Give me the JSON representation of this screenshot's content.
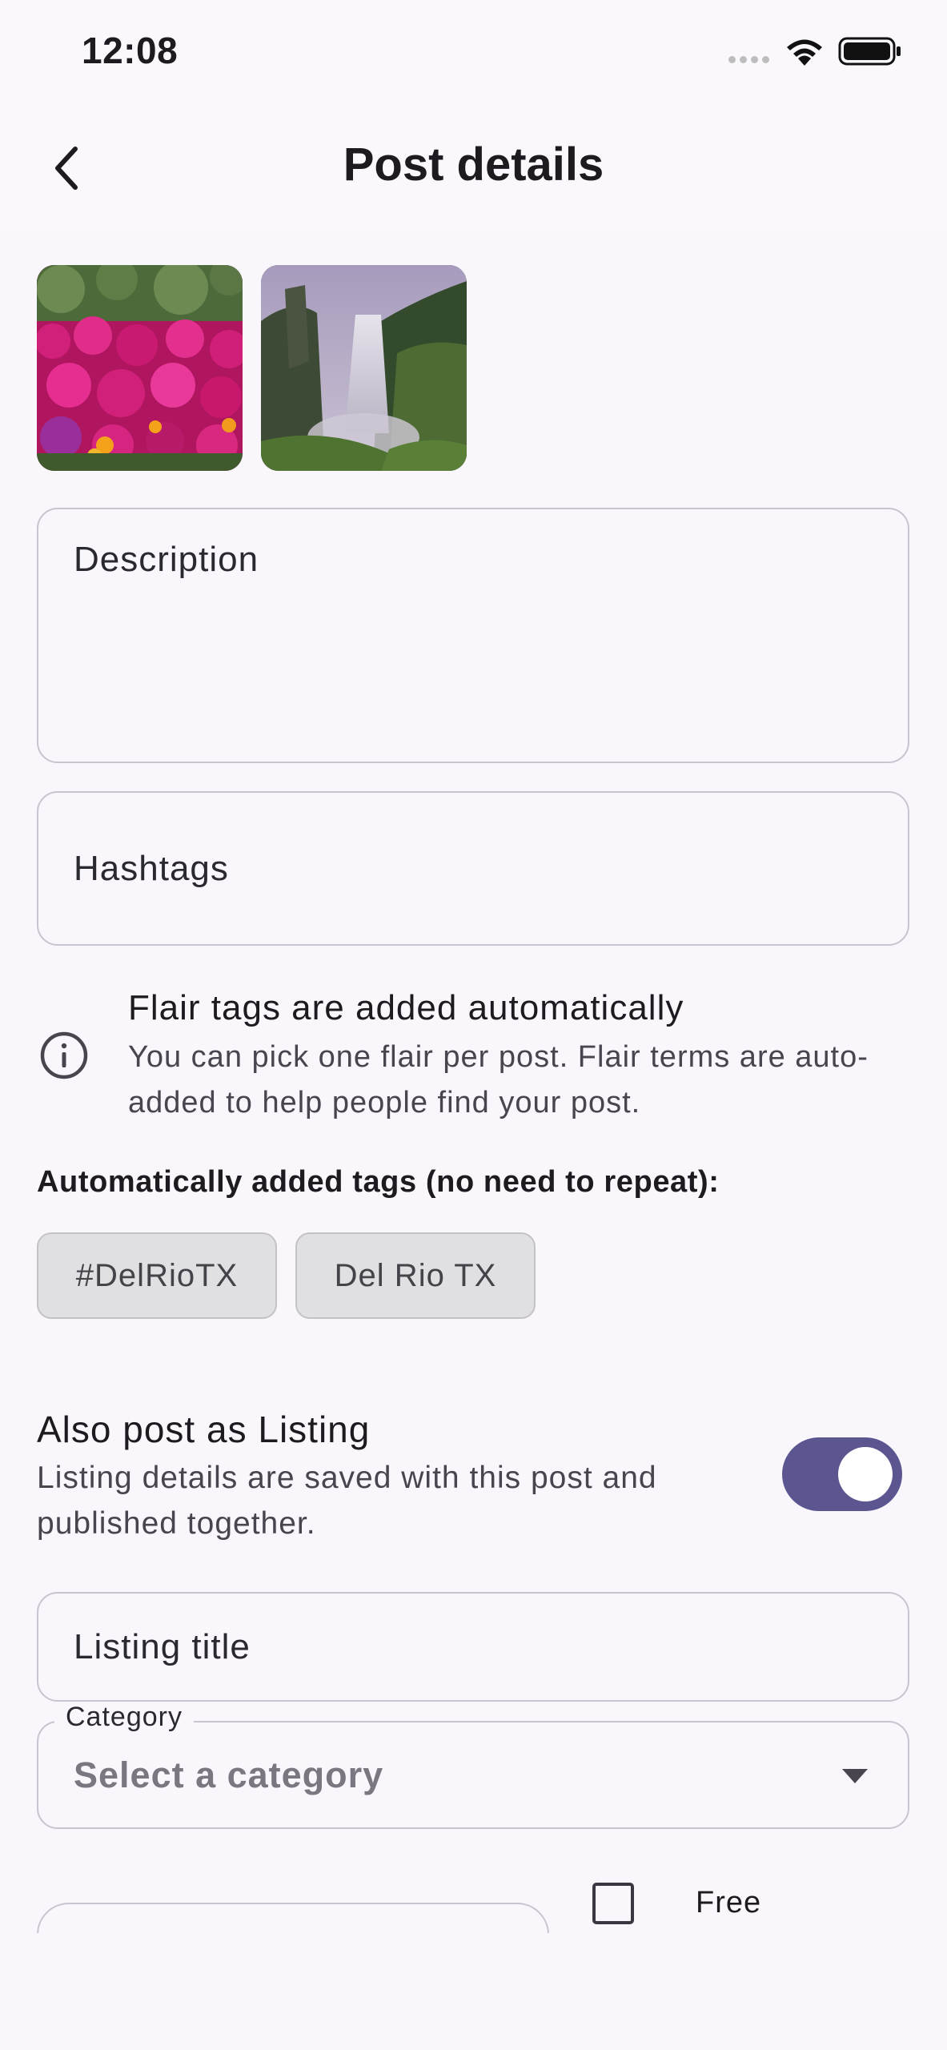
{
  "status_bar": {
    "time": "12:08"
  },
  "app_bar": {
    "title": "Post details"
  },
  "photos": [
    {
      "name": "photo-flowers"
    },
    {
      "name": "photo-waterfall"
    }
  ],
  "form": {
    "description_placeholder": "Description",
    "hashtags_placeholder": "Hashtags"
  },
  "info": {
    "title": "Flair tags are added automatically",
    "body": "You can pick one flair per post. Flair terms are auto-added to help people find your post."
  },
  "auto_tags": {
    "heading": "Automatically added tags (no need to repeat):",
    "chips": [
      "#DelRioTX",
      "Del Rio TX"
    ]
  },
  "listing": {
    "toggle_title": "Also post as Listing",
    "toggle_subtitle": "Listing details are saved with this post and published together.",
    "toggle_on": true,
    "title_placeholder": "Listing title",
    "category_label": "Category",
    "category_value": "Select a category",
    "free_label": "Free",
    "free_checked": false
  },
  "colors": {
    "accent": "#5b568f",
    "background": "#f9f6fc",
    "outline": "#c9c4cf",
    "chip_bg": "#e0dfe2"
  }
}
